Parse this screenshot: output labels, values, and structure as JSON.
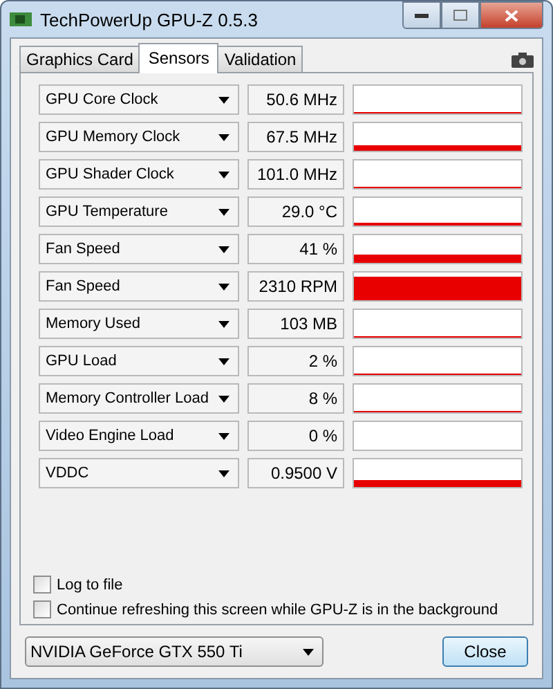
{
  "window": {
    "title": "TechPowerUp GPU-Z 0.5.3"
  },
  "tabs": [
    {
      "label": "Graphics Card",
      "selected": false
    },
    {
      "label": "Sensors",
      "selected": true
    },
    {
      "label": "Validation",
      "selected": false
    }
  ],
  "sensors": [
    {
      "name": "GPU Core Clock",
      "value": "50.6 MHz"
    },
    {
      "name": "GPU Memory Clock",
      "value": "67.5 MHz"
    },
    {
      "name": "GPU Shader Clock",
      "value": "101.0 MHz"
    },
    {
      "name": "GPU Temperature",
      "value": "29.0 °C"
    },
    {
      "name": "Fan Speed",
      "value": "41 %"
    },
    {
      "name": "Fan Speed",
      "value": "2310 RPM"
    },
    {
      "name": "Memory Used",
      "value": "103 MB"
    },
    {
      "name": "GPU Load",
      "value": "2 %"
    },
    {
      "name": "Memory Controller Load",
      "value": "8 %"
    },
    {
      "name": "Video Engine Load",
      "value": "0 %"
    },
    {
      "name": "VDDC",
      "value": "0.9500 V"
    }
  ],
  "options": [
    {
      "label": "Log to file",
      "checked": false
    },
    {
      "label": "Continue refreshing this screen while GPU-Z is in the background",
      "checked": false
    }
  ],
  "device": {
    "value": "NVIDIA GeForce GTX 550 Ti"
  },
  "buttons": [
    "Close"
  ]
}
